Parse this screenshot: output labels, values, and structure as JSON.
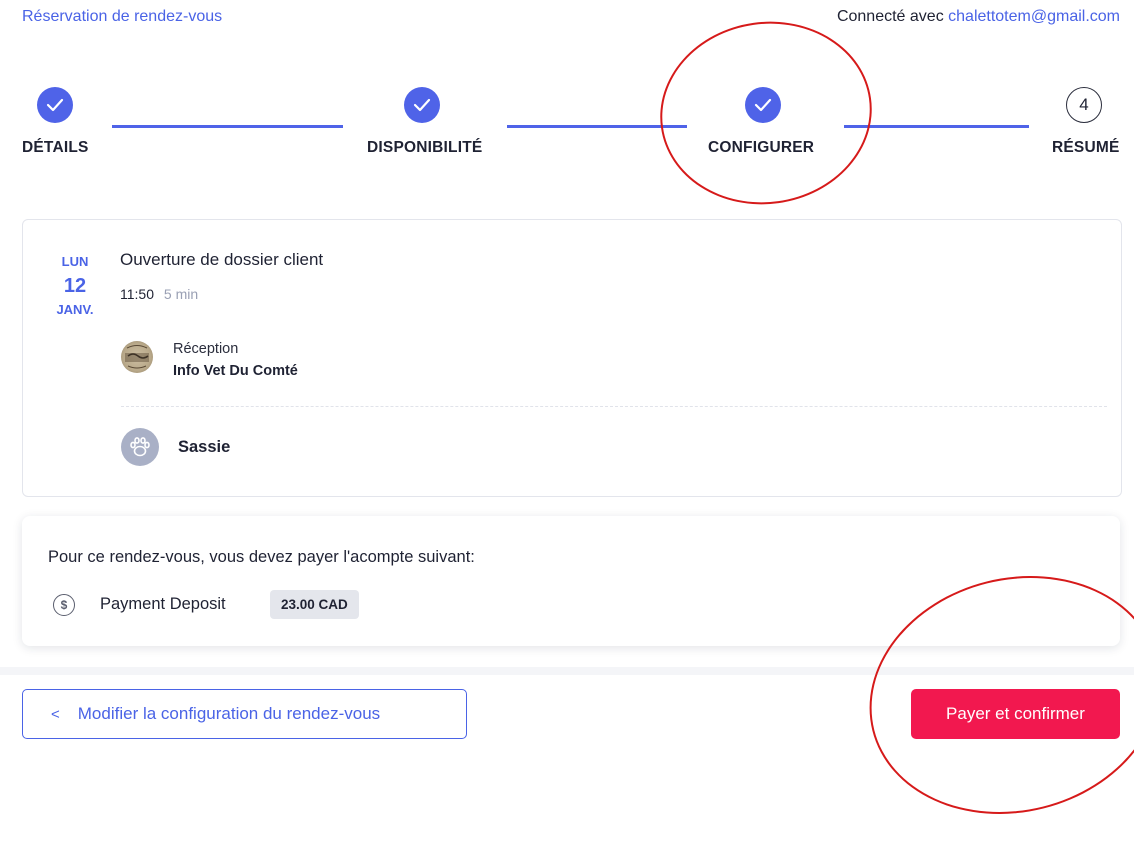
{
  "header": {
    "title": "Réservation de rendez-vous",
    "connected_prefix": "Connecté avec",
    "email": "chalettotem@gmail.com"
  },
  "stepper": {
    "steps": [
      {
        "label": "DÉTAILS",
        "state": "complete"
      },
      {
        "label": "DISPONIBILITÉ",
        "state": "complete"
      },
      {
        "label": "CONFIGURER",
        "state": "complete"
      },
      {
        "label": "RÉSUMÉ",
        "state": "current",
        "number": "4"
      }
    ]
  },
  "appointment": {
    "day_of_week": "LUN",
    "day": "12",
    "month": "JANV.",
    "title": "Ouverture de dossier client",
    "time": "11:50",
    "duration": "5 min",
    "staff_role": "Réception",
    "staff_name": "Info Vet Du Comté",
    "pet_name": "Sassie"
  },
  "payment": {
    "message": "Pour ce rendez-vous, vous devez payer l'acompte suivant:",
    "label": "Payment Deposit",
    "amount": "23.00 CAD"
  },
  "actions": {
    "back_label": "Modifier la configuration du rendez-vous",
    "confirm_label": "Payer et confirmer"
  },
  "colors": {
    "accent": "#4f63e8",
    "confirm": "#f2184f",
    "annotation": "#d61a1a"
  }
}
